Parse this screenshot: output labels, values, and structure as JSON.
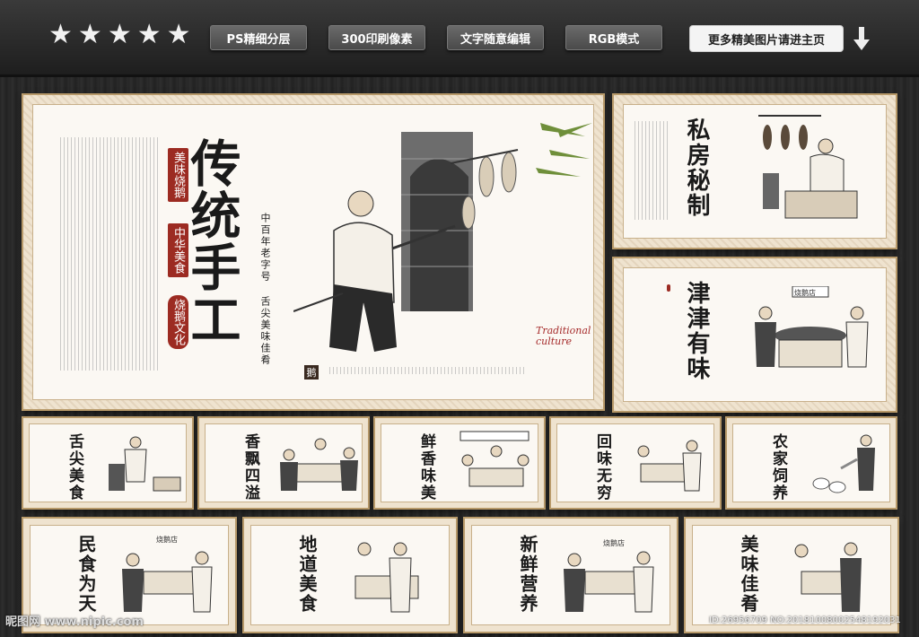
{
  "rating": {
    "stars": [
      "★",
      "★",
      "★",
      "★",
      "★"
    ]
  },
  "tags": [
    "PS精细分层",
    "300印刷像素",
    "文字随意编辑",
    "RGB模式"
  ],
  "more_button": "更多精美图片请进主页",
  "main_panel": {
    "title": "传统手工",
    "red_tags": [
      "美味烧鹅",
      "中华美食"
    ],
    "sub_tag": "烧鹅文化",
    "slogan": "中百年老字号 舌尖美味佳肴",
    "brand": "Traditional culture",
    "seal": "鹅"
  },
  "side_panels": [
    {
      "title": "私房秘制"
    },
    {
      "title": "津津有味",
      "sign": "烧鹅店"
    }
  ],
  "small_panels": [
    {
      "title": "舌尖美食"
    },
    {
      "title": "香飘四溢"
    },
    {
      "title": "鲜香味美"
    },
    {
      "title": "回味无穷"
    },
    {
      "title": "农家饲养"
    }
  ],
  "bottom_panels": [
    {
      "title": "民食为天",
      "sign": "烧鹅店"
    },
    {
      "title": "地道美食"
    },
    {
      "title": "新鲜营养",
      "sign": "烧鹅店"
    },
    {
      "title": "美味佳肴"
    }
  ],
  "watermark": {
    "left": "昵图网 www.nipic.com",
    "right": "ID:26956709 NO:20181008002548192031"
  },
  "colors": {
    "accent_red": "#9c2b22",
    "frame": "#b89a6a",
    "paper": "#fbf8f3"
  }
}
